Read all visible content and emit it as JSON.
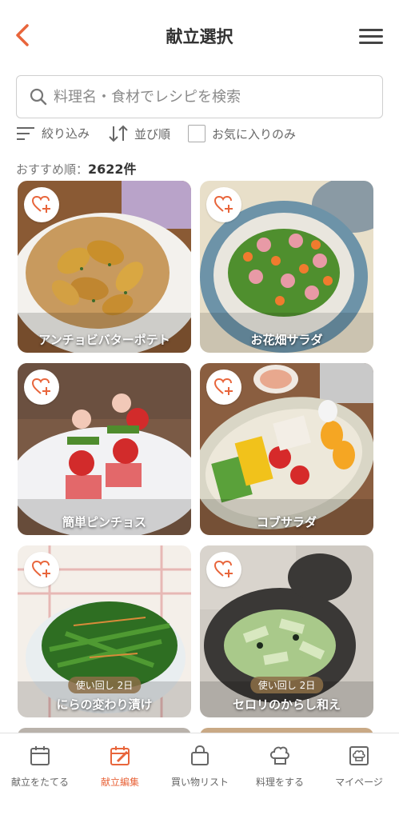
{
  "header": {
    "title": "献立選択",
    "back_icon": "chevron-left-icon",
    "menu_icon": "hamburger-menu-icon"
  },
  "search": {
    "placeholder": "料理名・食材でレシピを検索",
    "value": ""
  },
  "filters": {
    "refine_label": "絞り込み",
    "sort_label": "並び順",
    "favorites_only_label": "お気に入りのみ",
    "favorites_only_checked": false
  },
  "results": {
    "sort_prefix": "おすすめ順：",
    "count": "2622件"
  },
  "recipes": [
    {
      "title": "アンチョビバターポテト",
      "badge": ""
    },
    {
      "title": "お花畑サラダ",
      "badge": ""
    },
    {
      "title": "簡単ピンチョス",
      "badge": ""
    },
    {
      "title": "コブサラダ",
      "badge": ""
    },
    {
      "title": "にらの変わり漬け",
      "badge": "使い回し 2日"
    },
    {
      "title": "セロリのからし和え",
      "badge": "使い回し 2日"
    }
  ],
  "tabbar": {
    "active_index": 1,
    "accent_color": "#e8653b",
    "tabs": [
      {
        "label": "献立をたてる",
        "icon": "calendar-icon"
      },
      {
        "label": "献立編集",
        "icon": "calendar-edit-icon"
      },
      {
        "label": "買い物リスト",
        "icon": "shopping-bag-icon"
      },
      {
        "label": "料理をする",
        "icon": "chef-hat-icon"
      },
      {
        "label": "マイページ",
        "icon": "mypage-icon"
      }
    ]
  }
}
